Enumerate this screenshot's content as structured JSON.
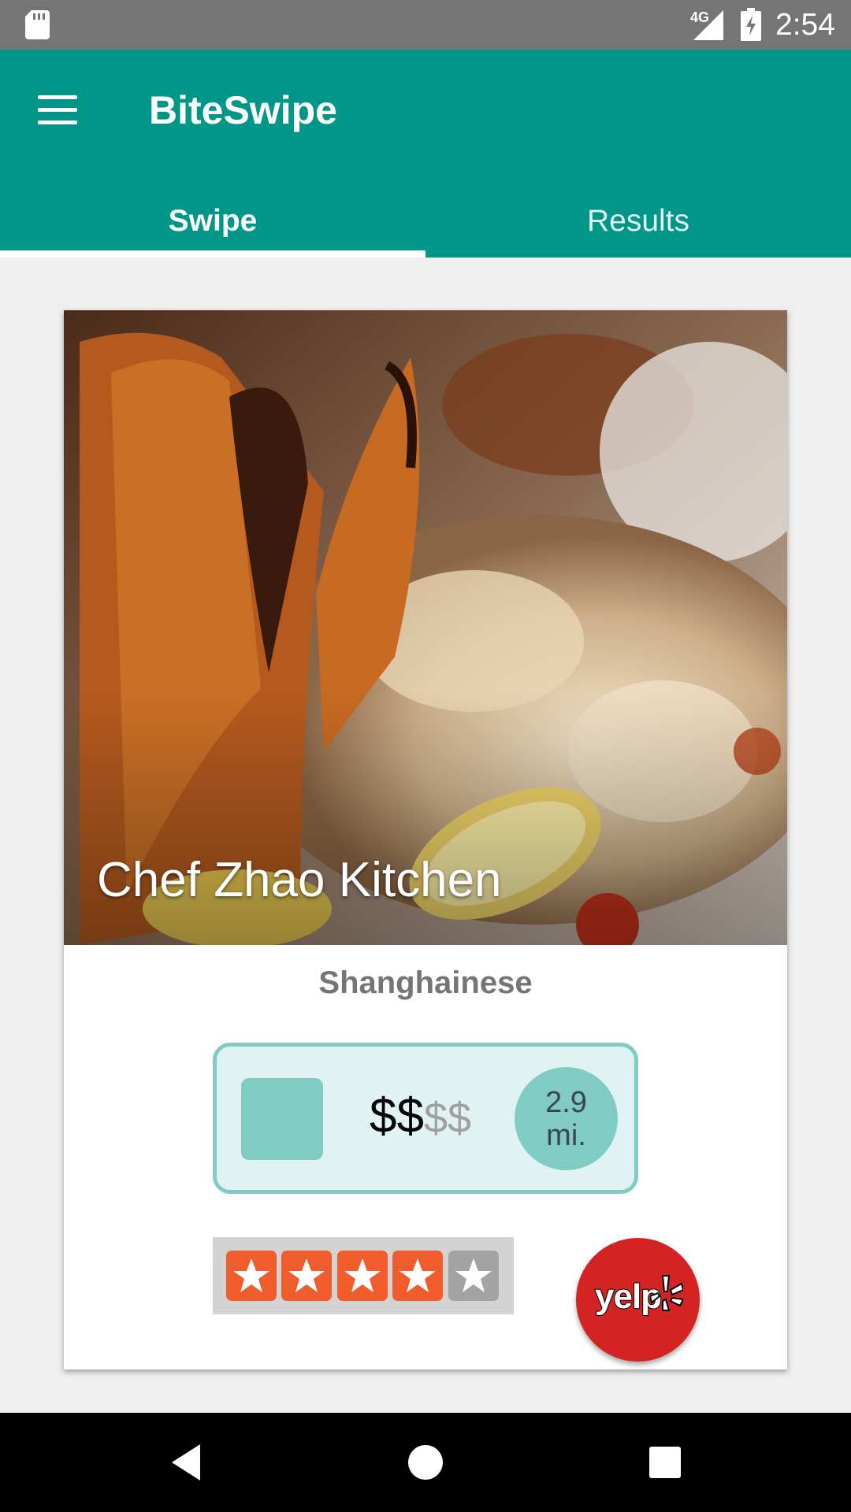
{
  "status_bar": {
    "network": "4G",
    "time": "2:54",
    "icons": [
      "sd-card-icon",
      "signal-icon",
      "battery-charging-icon"
    ]
  },
  "app_bar": {
    "title": "BiteSwipe",
    "menu_icon": "hamburger-menu-icon",
    "background_color": "#009688"
  },
  "tabs": [
    {
      "label": "Swipe",
      "active": true
    },
    {
      "label": "Results",
      "active": false
    }
  ],
  "card": {
    "name": "Chef Zhao Kitchen",
    "cuisine": "Shanghainese",
    "price_active": "$$",
    "price_inactive": "$$",
    "distance_value": "2.9",
    "distance_unit": "mi.",
    "rating": 4,
    "rating_max": 5,
    "star_colors": {
      "filled": "#f15c2d",
      "empty": "#a3a3a3"
    },
    "yelp_label": "yelp",
    "accent_color": "#80cbc4"
  },
  "nav_bar": {
    "icons": [
      "back-icon",
      "home-icon",
      "recents-icon"
    ]
  }
}
